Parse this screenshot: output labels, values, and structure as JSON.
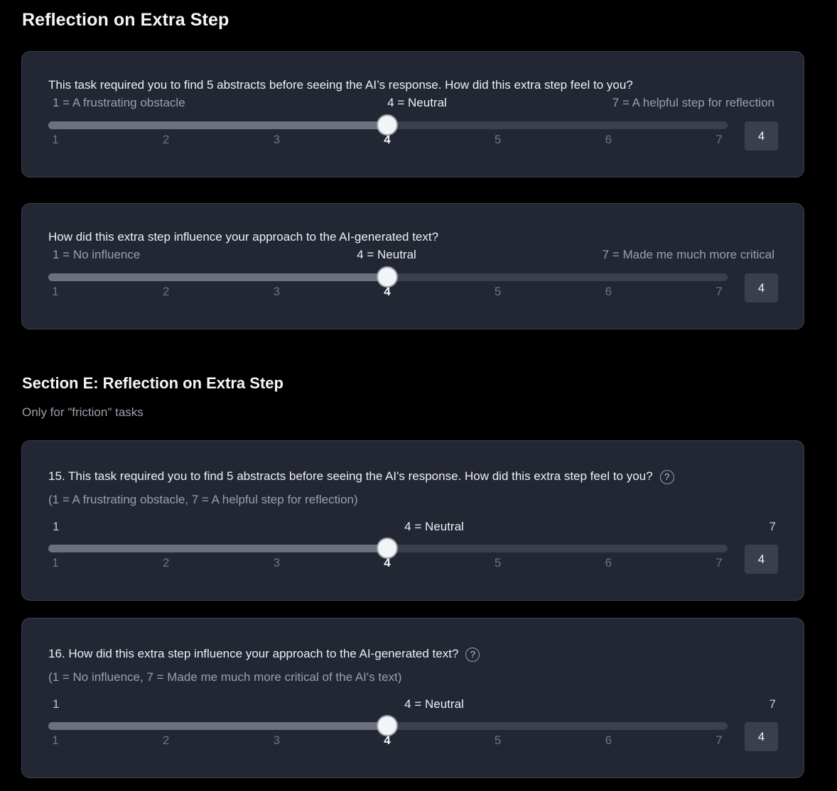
{
  "page_title": "Reflection on Extra Step",
  "section": {
    "title": "Section E: Reflection on Extra Step",
    "note": "Only for \"friction\" tasks"
  },
  "cards": [
    {
      "question": "This task required you to find 5 abstracts before seeing the AI’s response. How did this extra step feel to you?",
      "hint_left": "1 = A frustrating obstacle",
      "hint_mid": "4 = Neutral",
      "hint_right": "7 = A helpful step for reflection",
      "value": "4",
      "value_number": 4,
      "ticks": [
        "1",
        "2",
        "3",
        "4",
        "5",
        "6",
        "7"
      ]
    },
    {
      "question": "How did this extra step influence your approach to the AI-generated text?",
      "hint_left": "1 = No influence",
      "hint_mid": "4 = Neutral",
      "hint_right": "7 = Made me much more critical",
      "value": "4",
      "value_number": 4,
      "ticks": [
        "1",
        "2",
        "3",
        "4",
        "5",
        "6",
        "7"
      ]
    },
    {
      "question": "15. This task required you to find 5 abstracts before seeing the AI's response. How did this extra step feel to you?",
      "help_icon": "?",
      "subtext": "(1 = A frustrating obstacle, 7 = A helpful step for reflection)",
      "hint_left": "1",
      "hint_mid": "4 = Neutral",
      "hint_right": "7",
      "value": "4",
      "value_number": 4,
      "ticks": [
        "1",
        "2",
        "3",
        "4",
        "5",
        "6",
        "7"
      ]
    },
    {
      "question": "16. How did this extra step influence your approach to the AI-generated text?",
      "help_icon": "?",
      "subtext": "(1 = No influence, 7 = Made me much more critical of the AI's text)",
      "hint_left": "1",
      "hint_mid": "4 = Neutral",
      "hint_right": "7",
      "value": "4",
      "value_number": 4,
      "ticks": [
        "1",
        "2",
        "3",
        "4",
        "5",
        "6",
        "7"
      ]
    }
  ]
}
